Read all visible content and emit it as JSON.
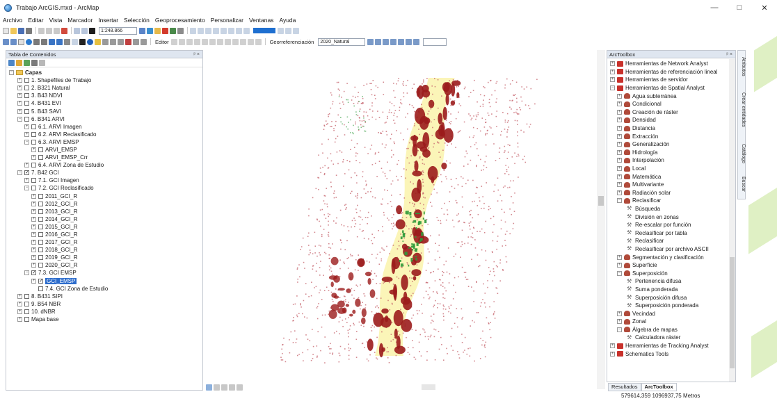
{
  "window": {
    "title": "Trabajo ArcGIS.mxd - ArcMap",
    "controls": [
      "—",
      "□",
      "✕"
    ]
  },
  "menu": [
    "Archivo",
    "Editar",
    "Vista",
    "Marcador",
    "Insertar",
    "Selección",
    "Geoprocesamiento",
    "Personalizar",
    "Ventanas",
    "Ayuda"
  ],
  "toolbar": {
    "scale": "1:248.866",
    "editor_label": "Editor",
    "georef_label": "Georreferenciación",
    "georef_layer": "2020_Natural"
  },
  "toc": {
    "title": "Tabla de Contenidos",
    "pin": "ᵖ ×",
    "items": [
      {
        "label": "Capas",
        "expander": "−",
        "checked": null
      },
      {
        "label": "1. Shapefiles de Trabajo",
        "expander": "+",
        "checked": false
      },
      {
        "label": "2. B321 Natural",
        "expander": "+",
        "checked": false
      },
      {
        "label": "3. B43 NDVI",
        "expander": "+",
        "checked": false
      },
      {
        "label": "4. B431 EVI",
        "expander": "+",
        "checked": false
      },
      {
        "label": "5. B43 SAVI",
        "expander": "+",
        "checked": false
      },
      {
        "label": "6. B341 ARVI",
        "expander": "−",
        "checked": false
      },
      {
        "label": "6.1. ARVI Imagen",
        "expander": "+",
        "checked": false
      },
      {
        "label": "6.2. ARVI Reclasificado",
        "expander": "+",
        "checked": false
      },
      {
        "label": "6.3. ARVI EMSP",
        "expander": "−",
        "checked": false
      },
      {
        "label": "ARVI_EMSP",
        "expander": "+",
        "checked": false
      },
      {
        "label": "ARVI_EMSP_Crr",
        "expander": "+",
        "checked": false
      },
      {
        "label": "6.4. ARVI Zona de Estudio",
        "expander": "+",
        "checked": false
      },
      {
        "label": "7. B42 GCI",
        "expander": "−",
        "checked": true
      },
      {
        "label": "7.1. GCI Imagen",
        "expander": "+",
        "checked": false
      },
      {
        "label": "7.2. GCI Reclasificado",
        "expander": "−",
        "checked": false
      },
      {
        "label": "2011_GCI_R",
        "expander": "+",
        "checked": false
      },
      {
        "label": "2012_GCI_R",
        "expander": "+",
        "checked": false
      },
      {
        "label": "2013_GCI_R",
        "expander": "+",
        "checked": false
      },
      {
        "label": "2014_GCI_R",
        "expander": "+",
        "checked": false
      },
      {
        "label": "2015_GCI_R",
        "expander": "+",
        "checked": false
      },
      {
        "label": "2016_GCI_R",
        "expander": "+",
        "checked": false
      },
      {
        "label": "2017_GCI_R",
        "expander": "+",
        "checked": false
      },
      {
        "label": "2018_GCI_R",
        "expander": "+",
        "checked": false
      },
      {
        "label": "2019_GCI_R",
        "expander": "+",
        "checked": false
      },
      {
        "label": "2020_GCI_R",
        "expander": "+",
        "checked": false
      },
      {
        "label": "7.3. GCI EMSP",
        "expander": "−",
        "checked": true
      },
      {
        "label": "GCI_EMSP",
        "expander": "+",
        "checked": true,
        "selected": true
      },
      {
        "label": "7.4. GCI Zona de Estudio",
        "expander": "",
        "checked": false
      },
      {
        "label": "8. B431 SIPI",
        "expander": "+",
        "checked": false
      },
      {
        "label": "9. B54 NBR",
        "expander": "+",
        "checked": false
      },
      {
        "label": "10. dNBR",
        "expander": "+",
        "checked": false
      },
      {
        "label": "Mapa base",
        "expander": "+",
        "checked": false
      }
    ]
  },
  "toolbox": {
    "title": "ArcToolbox",
    "pin": "ᵖ ×",
    "items": [
      {
        "label": "Herramientas de Network Analyst",
        "kind": "box",
        "expander": "+"
      },
      {
        "label": "Herramientas de referenciación lineal",
        "kind": "box",
        "expander": "+"
      },
      {
        "label": "Herramientas de servidor",
        "kind": "box",
        "expander": "+"
      },
      {
        "label": "Herramientas de Spatial Analyst",
        "kind": "box",
        "expander": "−"
      },
      {
        "label": "Agua subterránea",
        "kind": "set",
        "expander": "+"
      },
      {
        "label": "Condicional",
        "kind": "set",
        "expander": "+"
      },
      {
        "label": "Creación de ráster",
        "kind": "set",
        "expander": "+"
      },
      {
        "label": "Densidad",
        "kind": "set",
        "expander": "+"
      },
      {
        "label": "Distancia",
        "kind": "set",
        "expander": "+"
      },
      {
        "label": "Extracción",
        "kind": "set",
        "expander": "+"
      },
      {
        "label": "Generalización",
        "kind": "set",
        "expander": "+"
      },
      {
        "label": "Hidrología",
        "kind": "set",
        "expander": "+"
      },
      {
        "label": "Interpolación",
        "kind": "set",
        "expander": "+"
      },
      {
        "label": "Local",
        "kind": "set",
        "expander": "+"
      },
      {
        "label": "Matemática",
        "kind": "set",
        "expander": "+"
      },
      {
        "label": "Multivariante",
        "kind": "set",
        "expander": "+"
      },
      {
        "label": "Radiación solar",
        "kind": "set",
        "expander": "+"
      },
      {
        "label": "Reclasificar",
        "kind": "set",
        "expander": "−"
      },
      {
        "label": "Búsqueda",
        "kind": "tool",
        "expander": ""
      },
      {
        "label": "División en zonas",
        "kind": "tool",
        "expander": ""
      },
      {
        "label": "Re-escalar por función",
        "kind": "tool",
        "expander": ""
      },
      {
        "label": "Reclasificar por tabla",
        "kind": "tool",
        "expander": ""
      },
      {
        "label": "Reclasificar",
        "kind": "tool",
        "expander": ""
      },
      {
        "label": "Reclasificar por archivo ASCII",
        "kind": "tool",
        "expander": ""
      },
      {
        "label": "Segmentación y clasificación",
        "kind": "set",
        "expander": "+"
      },
      {
        "label": "Superficie",
        "kind": "set",
        "expander": "+"
      },
      {
        "label": "Superposición",
        "kind": "set",
        "expander": "−"
      },
      {
        "label": "Pertenencia difusa",
        "kind": "tool",
        "expander": ""
      },
      {
        "label": "Suma ponderada",
        "kind": "tool",
        "expander": ""
      },
      {
        "label": "Superposición difusa",
        "kind": "tool",
        "expander": ""
      },
      {
        "label": "Superposición ponderada",
        "kind": "tool",
        "expander": ""
      },
      {
        "label": "Vecindad",
        "kind": "set",
        "expander": "+"
      },
      {
        "label": "Zonal",
        "kind": "set",
        "expander": "+"
      },
      {
        "label": "Álgebra de mapas",
        "kind": "set",
        "expander": "−"
      },
      {
        "label": "Calculadora ráster",
        "kind": "tool",
        "expander": ""
      },
      {
        "label": "Herramientas de Tracking Analyst",
        "kind": "box",
        "expander": "+"
      },
      {
        "label": "Schematics Tools",
        "kind": "box",
        "expander": "+"
      }
    ],
    "tabs": [
      "Resultados",
      "ArcToolbox"
    ]
  },
  "side_tabs": [
    "Atributos",
    "Crear entidades",
    "Catálogo",
    "Buscar"
  ],
  "status": {
    "coordinates": "579614,359  1096937,75 Metros"
  },
  "map_colors": {
    "dark_red": "#9b1c1c",
    "red_dots": "#c4606a",
    "yellow": "#fbf4b0",
    "green": "#2f9a3a"
  }
}
